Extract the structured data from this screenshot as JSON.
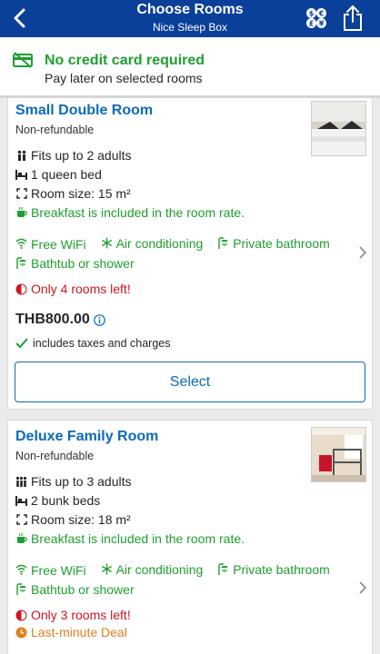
{
  "header": {
    "title": "Choose Rooms",
    "subtitle": "Nice Sleep Box",
    "currency_glyphs": "$€£¥"
  },
  "banner": {
    "headline": "No credit card required",
    "subline": "Pay later on selected rooms"
  },
  "rooms": [
    {
      "name": "Small Double Room",
      "policy": "Non-refundable",
      "occupancy": "Fits up to 2 adults",
      "bed": "1 queen bed",
      "size": "Room size: 15 m²",
      "breakfast": "Breakfast is included in the room rate.",
      "amenities": [
        "Free WiFi",
        "Air conditioning",
        "Private bathroom",
        "Bathtub or shower"
      ],
      "availability": "Only 4 rooms left!",
      "price": "THB800.00",
      "taxes": "includes taxes and charges",
      "select_label": "Select"
    },
    {
      "name": "Deluxe Family Room",
      "policy": "Non-refundable",
      "occupancy": "Fits up to 3 adults",
      "bed": "2 bunk beds",
      "size": "Room size: 18 m²",
      "breakfast": "Breakfast is included in the room rate.",
      "amenities": [
        "Free WiFi",
        "Air conditioning",
        "Private bathroom",
        "Bathtub or shower"
      ],
      "availability": "Only 3 rooms left!",
      "deal": "Last-minute Deal"
    }
  ],
  "colors": {
    "header_bg": "#0a3f9a",
    "link_blue": "#0a6bbd",
    "green": "#1f9e30",
    "red": "#d0161f",
    "orange": "#e0801e"
  }
}
